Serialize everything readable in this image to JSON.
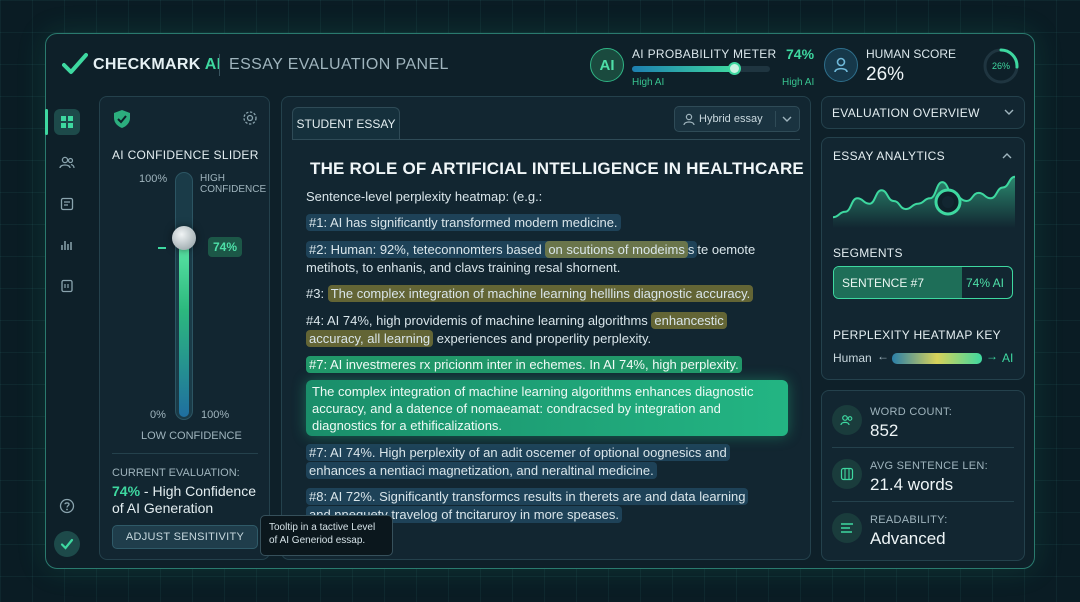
{
  "header": {
    "brand": "CHECKMARK",
    "brand_ai": "AI",
    "panel_title": "ESSAY EVALUATION PANEL",
    "ai_badge": "AI",
    "meter_label": "AI PROBABILITY METER",
    "meter_value": "74%",
    "meter_fraction": 0.74,
    "meter_left": "High AI",
    "meter_right": "High AI",
    "human_score_label": "HUMAN SCORE",
    "human_score_value": "26%",
    "human_ring_text": "26%",
    "human_fraction": 0.26
  },
  "sidebar": {
    "icons": [
      "dashboard-icon",
      "users-icon",
      "document-icon",
      "chart-icon",
      "report-icon"
    ],
    "bottom_icons": [
      "help-icon",
      "check-icon"
    ]
  },
  "confidence": {
    "title": "AI CONFIDENCE SLIDER",
    "top_label": "100%",
    "high_label_1": "HIGH",
    "high_label_2": "CONFIDENCE",
    "bottom_left": "0%",
    "bottom_right": "100%",
    "low_label": "LOW CONFIDENCE",
    "slider_value": "74%",
    "slider_fraction": 0.74,
    "current_label": "CURRENT EVALUATION:",
    "current_pct": "74%",
    "current_text_1": " - High Confidence",
    "current_text_2": "of AI Generation",
    "adjust_button": "ADJUST SENSITIVITY",
    "tooltip": "Tooltip in a tactive Level of AI Generiod essap."
  },
  "essay": {
    "tab": "STUDENT ESSAY",
    "dropdown": "Hybrid essay",
    "title": "THE ROLE OF ARTIFICIAL INTELLIGENCE IN HEALTHCARE",
    "intro": "Sentence-level perplexity heatmap: (e.g.:",
    "s1": "#1: AI has significantly transformed modern medicine.",
    "s2a_pre": "#2: Human: 92%, teteconnomters based ",
    "s2a_hl": "on scutions of modeims",
    "s2a_post": "s",
    "s2a_tail": "te oemote",
    "s2b": "metihots, to enhanis, and clavs training resal shornent.",
    "s3_pre": "#3: ",
    "s3_hl": "The complex integration of machine learning helllins diagnostic accuracy.",
    "s4a_pre": "#4: AI 74%, high providemis of machine learning algorithms ",
    "s4a_hl": "enhancestic",
    "s4b_hl": "accuracy, all learning",
    "s4b_post": " experiences and properlity perplexity.",
    "s5": "#7: AI investmeres rx pricionm inter in echemes. In AI 74%, high perplexity.",
    "g1": "The complex integration of machine learning algorithms enhances diagnostic",
    "g2": "accuracy, and a datence of nomaeamat: condracsed by integration and",
    "g3": "diagnostics for a ethificalizations.",
    "s6a": "#7: AI 74%.  High perplexity of an adit oscemer of optional oognesics and",
    "s6b": "enhances a nentiaci magnetization, and neraltinal medicine.",
    "s7a": "#8: AI 72%. Significantly transformcs results in therets are and data learning",
    "s7b": "and nnequety travelog of tncitaruroy in more speases."
  },
  "overview": {
    "title": "EVALUATION OVERVIEW"
  },
  "analytics": {
    "title": "ESSAY ANALYTICS",
    "segments_title": "SEGMENTS",
    "segment_label": "SENTENCE #7",
    "segment_value": "74% AI",
    "heatmap_key_title": "PERPLEXITY HEATMAP KEY",
    "key_left": "Human",
    "key_right": "AI",
    "chart_points": [
      0.2,
      0.3,
      0.55,
      0.45,
      0.7,
      0.5,
      0.35,
      0.45,
      0.55,
      0.85,
      0.6,
      0.5,
      0.65,
      0.55,
      0.75,
      0.95
    ]
  },
  "stats": {
    "word_count_label": "WORD COUNT:",
    "word_count_value": "852",
    "avg_label": "AVG SENTENCE LEN:",
    "avg_value": "21.4 words",
    "readability_label": "READABILITY:",
    "readability_value": "Advanced"
  },
  "colors": {
    "accent": "#3ed8a0",
    "highlight_yellow": "#c8b43c",
    "highlight_green": "#23b583",
    "highlight_blue": "#285a78"
  }
}
